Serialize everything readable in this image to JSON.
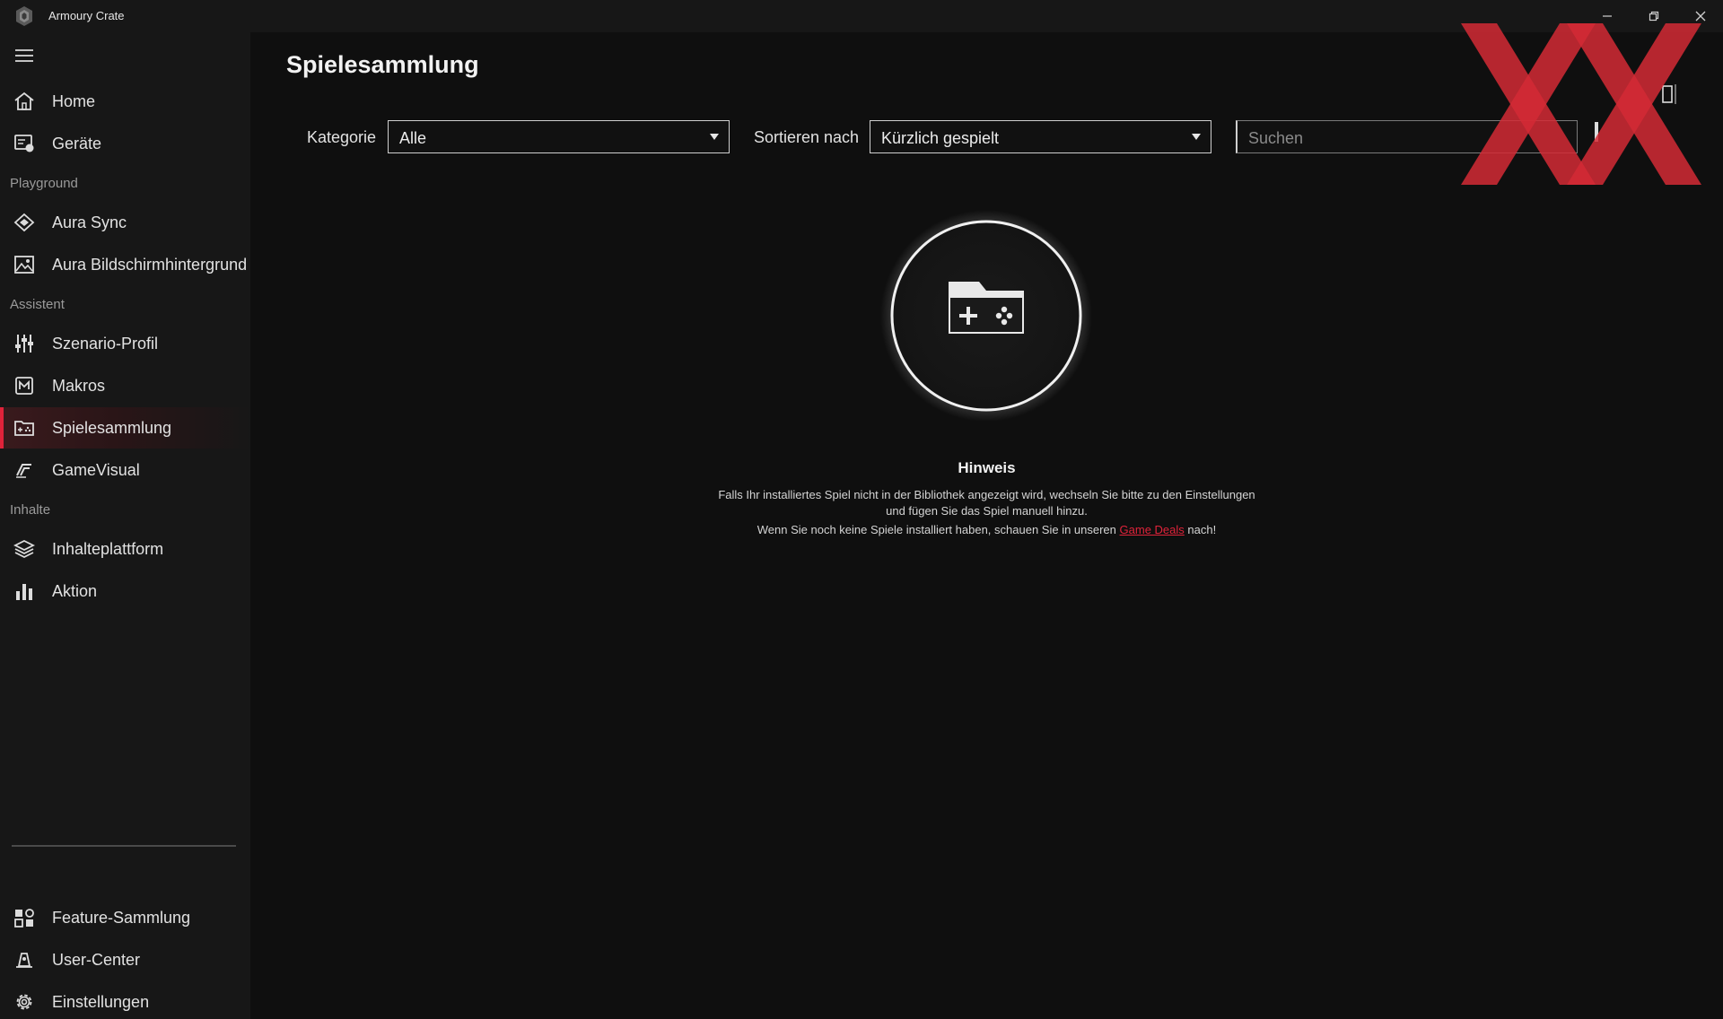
{
  "app": {
    "title": "Armoury Crate"
  },
  "window_controls": {
    "minimize": "minimize-icon",
    "restore": "restore-icon",
    "close": "close-icon"
  },
  "sidebar": {
    "items_top": [
      {
        "label": "Home",
        "icon": "home-icon"
      },
      {
        "label": "Geräte",
        "icon": "devices-icon"
      }
    ],
    "section_playground": "Playground",
    "items_playground": [
      {
        "label": "Aura Sync",
        "icon": "aura-sync-icon"
      },
      {
        "label": "Aura Bildschirmhintergrund",
        "icon": "wallpaper-icon"
      }
    ],
    "section_assistant": "Assistent",
    "items_assistant": [
      {
        "label": "Szenario-Profil",
        "icon": "sliders-icon"
      },
      {
        "label": "Makros",
        "icon": "macro-icon"
      },
      {
        "label": "Spielesammlung",
        "icon": "game-library-icon",
        "active": true
      },
      {
        "label": "GameVisual",
        "icon": "gamevisual-icon"
      }
    ],
    "section_content": "Inhalte",
    "items_content": [
      {
        "label": "Inhalteplattform",
        "icon": "layers-icon"
      },
      {
        "label": "Aktion",
        "icon": "bar-chart-icon"
      }
    ],
    "items_bottom": [
      {
        "label": "Feature-Sammlung",
        "icon": "feature-grid-icon"
      },
      {
        "label": "User-Center",
        "icon": "user-center-icon"
      },
      {
        "label": "Einstellungen",
        "icon": "gear-icon"
      }
    ]
  },
  "main": {
    "title": "Spielesammlung",
    "filters": {
      "category_label": "Kategorie",
      "category_value": "Alle",
      "sort_label": "Sortieren nach",
      "sort_value": "Kürzlich gespielt",
      "search_placeholder": "Suchen"
    },
    "empty_state": {
      "title": "Hinweis",
      "line1": "Falls Ihr installiertes Spiel nicht in der Bibliothek angezeigt wird, wechseln Sie bitte zu den Einstellungen",
      "line2": "und fügen Sie das Spiel manuell hinzu.",
      "line3_prefix": "Wenn Sie noch keine Spiele installiert haben, schauen Sie in unseren",
      "line3_link": "Game Deals",
      "line3_suffix": "nach!"
    }
  },
  "colors": {
    "accent": "#e0233a",
    "sidebar_bg": "#171717",
    "main_bg": "#0f0f0f",
    "watermark": "#d42a35"
  }
}
